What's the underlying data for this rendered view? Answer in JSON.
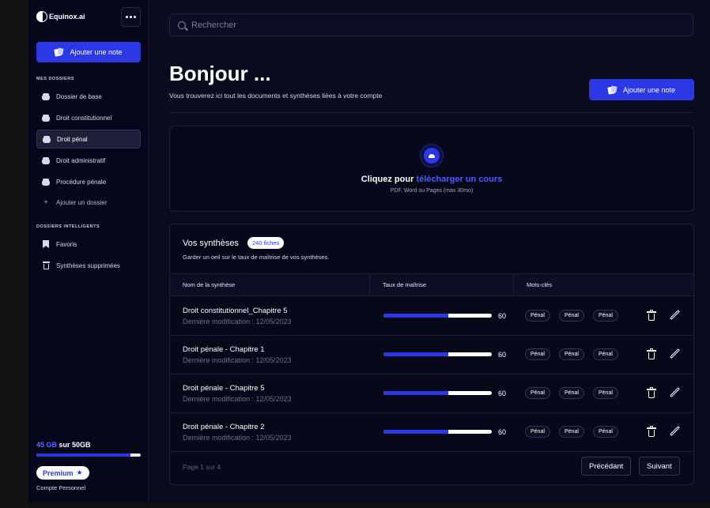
{
  "sidebar": {
    "brand": "Equinox.ai",
    "add_note_label": "Ajouter une note",
    "folders_title": "MES DOSSIERS",
    "folders": [
      {
        "label": "Dossier de base"
      },
      {
        "label": "Droit constitutionnel"
      },
      {
        "label": "Droit pénal",
        "active": true
      },
      {
        "label": "Droit administratif"
      },
      {
        "label": "Procédure pénale"
      }
    ],
    "add_folder_label": "Ajouter un dossier",
    "smart_title": "DOSSIERS INTELLIGENTS",
    "smart_folders": [
      {
        "label": "Favoris",
        "icon": "bookmark-icon"
      },
      {
        "label": "Synthèses supprimées",
        "icon": "trash-icon"
      }
    ],
    "storage": {
      "used": "45 GB",
      "rest": " sur 50GB",
      "fraction": 0.9
    },
    "premium_label": "Premium",
    "account_label": "Compte Personnel"
  },
  "main": {
    "search_placeholder": "Rechercher",
    "greeting": "Bonjour ...",
    "subtitle": "Vous trouverez ici tout les documents et synthèses liées à votre compte",
    "add_note_label": "Ajouter une note",
    "upload": {
      "cta_prefix": "Cliquez pour ",
      "cta_link": "télécharger un cours",
      "hint": "PDF, Word ou Pages (max 30mo)"
    },
    "list": {
      "title": "Vos synthèses",
      "count": "240 fiches",
      "description": "Garder un oeil sur le taux de maîtrise de vos synthèses.",
      "columns": [
        "Nom de la synthèse",
        "Taux de maîtrise",
        "Mots-clés"
      ],
      "rows": [
        {
          "title": "Droit constitutionnel_Chapitre 5",
          "date": "Dernière modification : 12/05/2023",
          "mastery": 60,
          "tags": [
            "Pénal",
            "Pénal",
            "Pénal"
          ]
        },
        {
          "title": "Droit pénale - Chapitre 1",
          "date": "Dernière modification : 12/05/2023",
          "mastery": 60,
          "tags": [
            "Pénal",
            "Pénal",
            "Pénal"
          ]
        },
        {
          "title": "Droit pénale - Chapitre 5",
          "date": "Dernière modification : 12/05/2023",
          "mastery": 60,
          "tags": [
            "Pénal",
            "Pénal",
            "Pénal"
          ]
        },
        {
          "title": "Droit pénale - Chapitre 2",
          "date": "Dernière modification : 12/05/2023",
          "mastery": 60,
          "tags": [
            "Pénal",
            "Pénal",
            "Pénal"
          ]
        }
      ],
      "pagination": {
        "text": "Page 1 sur 4",
        "prev": "Précédant",
        "next": "Suivant"
      }
    }
  },
  "colors": {
    "accent": "#2b38e6",
    "background": "#0a0b1f",
    "sidebar": "#06071a"
  }
}
